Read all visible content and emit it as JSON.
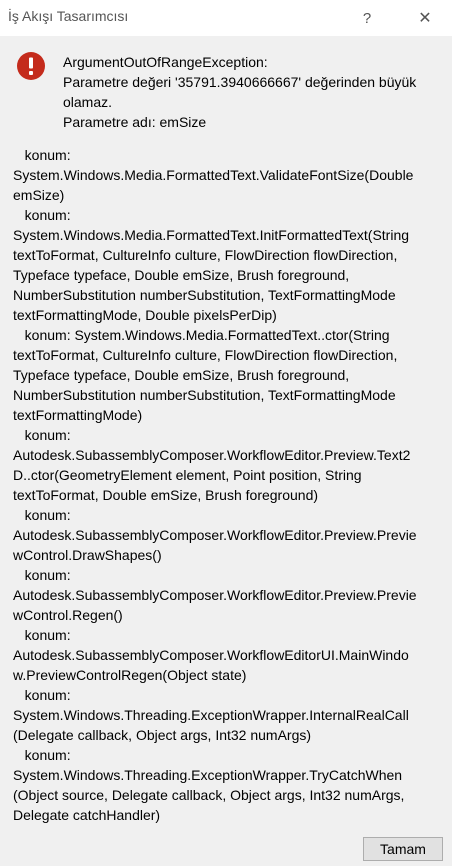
{
  "window": {
    "title": "İş Akışı Tasarımcısı",
    "help_label": "?",
    "close_label": "✕"
  },
  "error_icon": "error-circle-exclamation-icon",
  "colors": {
    "error_red": "#c42b1c",
    "button_bg": "#e1e1e1",
    "dialog_bg": "#f0f0f0"
  },
  "message": {
    "lines": [
      "ArgumentOutOfRangeException:",
      "Parametre değeri '35791.3940666667' değerinden büyük",
      "olamaz.",
      "Parametre adı: emSize"
    ]
  },
  "stack_trace": {
    "lines": [
      "   konum:",
      "System.Windows.Media.FormattedText.ValidateFontSize(Double",
      "emSize)",
      "   konum:",
      "System.Windows.Media.FormattedText.InitFormattedText(String",
      "textToFormat, CultureInfo culture, FlowDirection flowDirection,",
      "Typeface typeface, Double emSize, Brush foreground,",
      "NumberSubstitution numberSubstitution, TextFormattingMode",
      "textFormattingMode, Double pixelsPerDip)",
      "   konum: System.Windows.Media.FormattedText..ctor(String",
      "textToFormat, CultureInfo culture, FlowDirection flowDirection,",
      "Typeface typeface, Double emSize, Brush foreground,",
      "NumberSubstitution numberSubstitution, TextFormattingMode",
      "textFormattingMode)",
      "   konum:",
      "Autodesk.SubassemblyComposer.WorkflowEditor.Preview.Text2",
      "D..ctor(GeometryElement element, Point position, String",
      "textToFormat, Double emSize, Brush foreground)",
      "   konum:",
      "Autodesk.SubassemblyComposer.WorkflowEditor.Preview.Previe",
      "wControl.DrawShapes()",
      "   konum:",
      "Autodesk.SubassemblyComposer.WorkflowEditor.Preview.Previe",
      "wControl.Regen()",
      "   konum:",
      "Autodesk.SubassemblyComposer.WorkflowEditorUI.MainWindo",
      "w.PreviewControlRegen(Object state)",
      "   konum:",
      "System.Windows.Threading.ExceptionWrapper.InternalRealCall",
      "(Delegate callback, Object args, Int32 numArgs)",
      "   konum:",
      "System.Windows.Threading.ExceptionWrapper.TryCatchWhen",
      "(Object source, Delegate callback, Object args, Int32 numArgs,",
      "Delegate catchHandler)"
    ]
  },
  "buttons": {
    "ok_label": "Tamam"
  }
}
